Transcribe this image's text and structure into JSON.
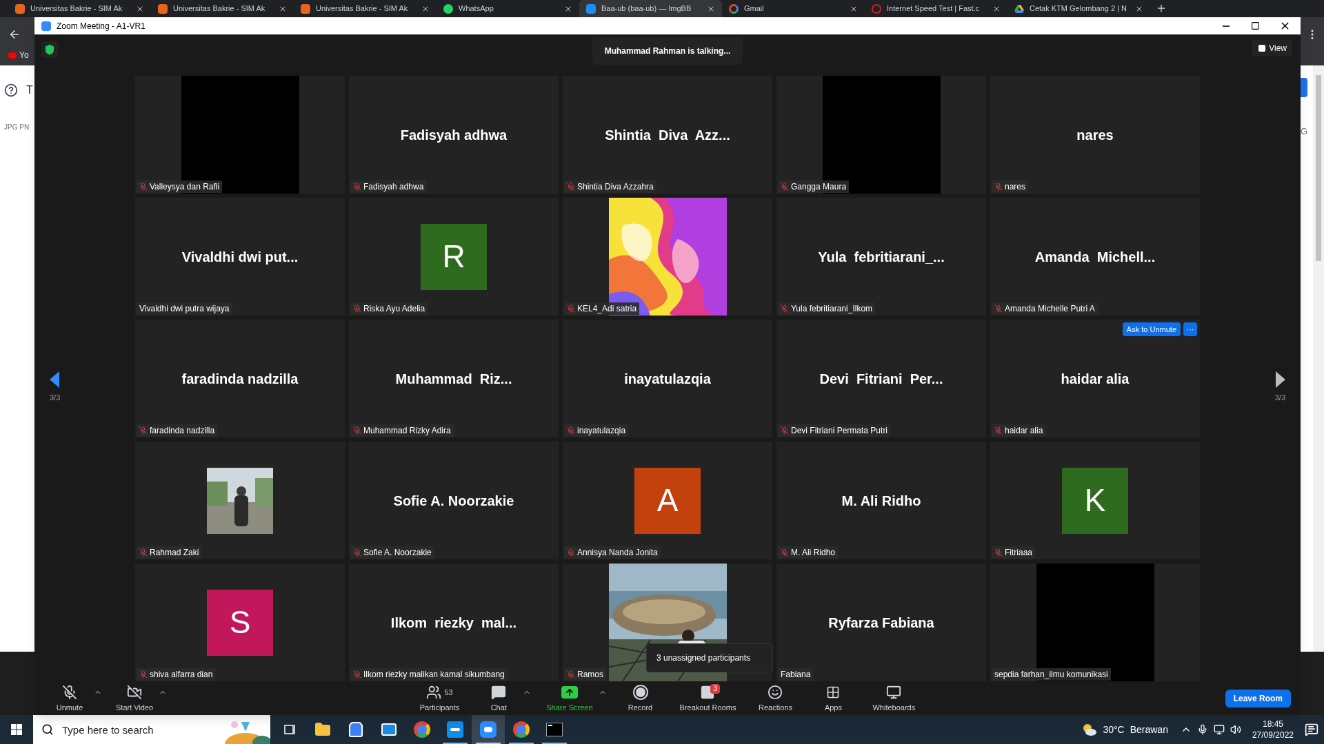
{
  "browser": {
    "tabs": [
      {
        "title": "Universitas Bakrie - SIM Ak",
        "kind": "bakrie",
        "selected": false
      },
      {
        "title": "Universitas Bakrie - SIM Ak",
        "kind": "bakrie",
        "selected": false
      },
      {
        "title": "Universitas Bakrie - SIM Ak",
        "kind": "bakrie",
        "selected": false
      },
      {
        "title": "WhatsApp",
        "kind": "whatsapp",
        "selected": false
      },
      {
        "title": "Baa-ub (baa-ub) — ImgBB",
        "kind": "imgbb",
        "selected": true
      },
      {
        "title": "Gmail",
        "kind": "google",
        "selected": false
      },
      {
        "title": "Internet Speed Test | Fast.c",
        "kind": "speedtest",
        "selected": false
      },
      {
        "title": "Cetak KTM Gelombang 2 | N",
        "kind": "drive",
        "selected": false
      }
    ],
    "bookmark": "Yo",
    "left_page": {
      "heading": "T",
      "label": "JPG PN"
    },
    "right_page": {
      "label": "G"
    }
  },
  "window": {
    "title": "Zoom Meeting - A1-VR1"
  },
  "talking": "Muhammad Rahman is talking...",
  "view_button": "View",
  "pager": {
    "prev": {
      "label": "3/3",
      "highlighted": true
    },
    "next": {
      "label": "3/3",
      "highlighted": false
    }
  },
  "tiles": [
    {
      "kind": "video-off",
      "name": "Valleysya dan Rafli",
      "muted": true
    },
    {
      "kind": "name",
      "title": "Fadisyah adhwa",
      "name": "Fadisyah adhwa",
      "muted": true
    },
    {
      "kind": "name",
      "title": "Shintia  Diva  Azz...",
      "name": "Shintia Diva Azzahra",
      "muted": true
    },
    {
      "kind": "video-off",
      "name": "Gangga Maura",
      "muted": true
    },
    {
      "kind": "name",
      "title": "nares",
      "name": "nares",
      "muted": true
    },
    {
      "kind": "name",
      "title": "Vivaldhi dwi put...",
      "name": "Vivaldhi dwi putra wijaya",
      "muted": false
    },
    {
      "kind": "avatar",
      "letter": "R",
      "color": "#2f6b1f",
      "name": "Riska Ayu Adelia",
      "muted": true
    },
    {
      "kind": "picture",
      "name": "KEL4_Adi satria",
      "muted": true
    },
    {
      "kind": "name",
      "title": "Yula  febritiarani_...",
      "name": "Yula febritiarani_Ilkom",
      "muted": true
    },
    {
      "kind": "name",
      "title": "Amanda  Michell...",
      "name": "Amanda Michelle Putri A",
      "muted": true
    },
    {
      "kind": "name",
      "title": "faradinda nadzilla",
      "name": "faradinda nadzilla",
      "muted": true
    },
    {
      "kind": "name",
      "title": "Muhammad  Riz...",
      "name": "Muhammad Rizky Adira",
      "muted": true
    },
    {
      "kind": "name",
      "title": "inayatulazqia",
      "name": "inayatulazqia",
      "muted": true
    },
    {
      "kind": "name",
      "title": "Devi  Fitriani  Per...",
      "name": "Devi Fitriani Permata Putri",
      "muted": true
    },
    {
      "kind": "name",
      "title": "haidar alia",
      "name": "haidar alia",
      "muted": true,
      "actions": {
        "button": "Ask to Unmute",
        "more": "···"
      }
    },
    {
      "kind": "photo-avatar",
      "name": "Rahmad Zaki",
      "muted": true
    },
    {
      "kind": "name",
      "title": "Sofie A. Noorzakie",
      "name": "Sofie A. Noorzakie",
      "muted": true
    },
    {
      "kind": "avatar",
      "letter": "A",
      "color": "#c2410c",
      "name": "Annisya Nanda Jonita",
      "muted": true
    },
    {
      "kind": "name",
      "title": "M. Ali Ridho",
      "name": "M. Ali Ridho",
      "muted": true
    },
    {
      "kind": "avatar",
      "letter": "K",
      "color": "#2f6b1f",
      "name": "Fitriaaa",
      "muted": true
    },
    {
      "kind": "avatar",
      "letter": "S",
      "color": "#c2185b",
      "name": "shiva alfarra dian",
      "muted": true
    },
    {
      "kind": "name",
      "title": "Ilkom  riezky  mal...",
      "name": "Ilkom riezky malikan kamal sikumbang",
      "muted": true
    },
    {
      "kind": "picture",
      "name": "Ramos",
      "muted": true
    },
    {
      "kind": "name",
      "title": "Ryfarza Fabiana",
      "name": "Fabiana",
      "muted": false
    },
    {
      "kind": "video-off",
      "name": "sepdia farhan_ilmu komunikasi",
      "muted": false
    }
  ],
  "popup": "3 unassigned participants",
  "toolbar": [
    {
      "kind": "mic-off",
      "label": "Unmute",
      "caret": true,
      "accent": false
    },
    {
      "kind": "video-off",
      "label": "Start Video",
      "caret": true,
      "accent": false
    },
    {
      "kind": "participants",
      "label": "Participants",
      "count": "53",
      "caret": false,
      "accent": false
    },
    {
      "kind": "chat",
      "label": "Chat",
      "caret": true,
      "accent": false
    },
    {
      "kind": "share",
      "label": "Share Screen",
      "caret": true,
      "accent": true
    },
    {
      "kind": "record",
      "label": "Record",
      "caret": false,
      "accent": false
    },
    {
      "kind": "breakout",
      "label": "Breakout Rooms",
      "badge": "3",
      "caret": false,
      "accent": false
    },
    {
      "kind": "reactions",
      "label": "Reactions",
      "caret": false,
      "accent": false
    },
    {
      "kind": "apps",
      "label": "Apps",
      "caret": false,
      "accent": false
    },
    {
      "kind": "whiteboards",
      "label": "Whiteboards",
      "caret": false,
      "accent": false
    }
  ],
  "leave_button": "Leave Room",
  "taskbar": {
    "search": {
      "placeholder": "Type here to search"
    },
    "apps": [
      {
        "kind": "taskview",
        "running": false,
        "selected": false
      },
      {
        "kind": "explorer",
        "running": false,
        "selected": false
      },
      {
        "kind": "store",
        "running": false,
        "selected": false
      },
      {
        "kind": "mail",
        "running": false,
        "selected": false
      },
      {
        "kind": "chrome",
        "running": false,
        "selected": false
      },
      {
        "kind": "teamviewer",
        "running": true,
        "selected": false
      },
      {
        "kind": "zoom",
        "running": true,
        "selected": true
      },
      {
        "kind": "chrome-profile",
        "running": true,
        "selected": false
      },
      {
        "kind": "terminal",
        "running": true,
        "selected": false
      }
    ],
    "weather": {
      "temp": "30°C",
      "condition": "Berawan"
    },
    "time": "18:45",
    "date": "27/09/2022"
  }
}
